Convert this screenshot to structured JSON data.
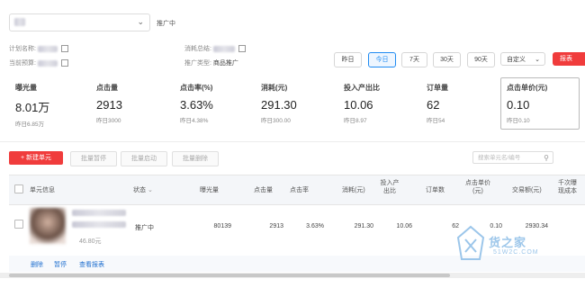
{
  "header": {
    "plan_dropdown_value": "",
    "status": "推广中",
    "plan_name_label": "计划名称:",
    "consume_label": "消耗总结:",
    "budget_label": "当前预算:",
    "promo_type_label": "推广类型:",
    "promo_type_value": "商品推广"
  },
  "date_filter": {
    "buttons": [
      "昨日",
      "今日",
      "7天",
      "30天",
      "90天"
    ],
    "active": "今日",
    "custom_label": "自定义",
    "report_label": "报表"
  },
  "metrics": [
    {
      "label": "曝光量",
      "value": "8.01万",
      "sub": "昨日6.85万"
    },
    {
      "label": "点击量",
      "value": "2913",
      "sub": "昨日3000"
    },
    {
      "label": "点击率(%)",
      "value": "3.63%",
      "sub": "昨日4.38%"
    },
    {
      "label": "消耗(元)",
      "value": "291.30",
      "sub": "昨日300.00"
    },
    {
      "label": "投入产出比",
      "value": "10.06",
      "sub": "昨日8.97"
    },
    {
      "label": "订单量",
      "value": "62",
      "sub": "昨日54"
    },
    {
      "label": "点击单价(元)",
      "value": "0.10",
      "sub": "昨日0.10"
    }
  ],
  "actions": {
    "new_unit": "+ 新建单元",
    "batch_pause": "批量暂停",
    "batch_start": "批量启动",
    "batch_delete": "批量删除",
    "search_placeholder": "搜索单元名/编号"
  },
  "table": {
    "headers": {
      "unit_info": "单元信息",
      "status": "状态",
      "impressions": "曝光量",
      "clicks": "点击量",
      "ctr": "点击率",
      "cost": "消耗(元)",
      "roi_line1": "投入产",
      "roi_line2": "出比",
      "orders": "订单数",
      "cpc_line1": "点击单价",
      "cpc_line2": "(元)",
      "gmv": "交易额(元)",
      "cpm_line1": "千次曝",
      "cpm_line2": "现成本"
    },
    "rows": [
      {
        "price_text": "46.80元",
        "status": "推广中",
        "impressions": "80139",
        "clicks": "2913",
        "ctr": "3.63%",
        "cost": "291.30",
        "roi": "10.06",
        "orders": "62",
        "cpc": "0.10",
        "gmv": "2930.34"
      }
    ],
    "row_ops": [
      "删除",
      "暂停",
      "查看报表"
    ]
  },
  "watermark": {
    "name": "货之家",
    "url": "51W2C.COM"
  }
}
